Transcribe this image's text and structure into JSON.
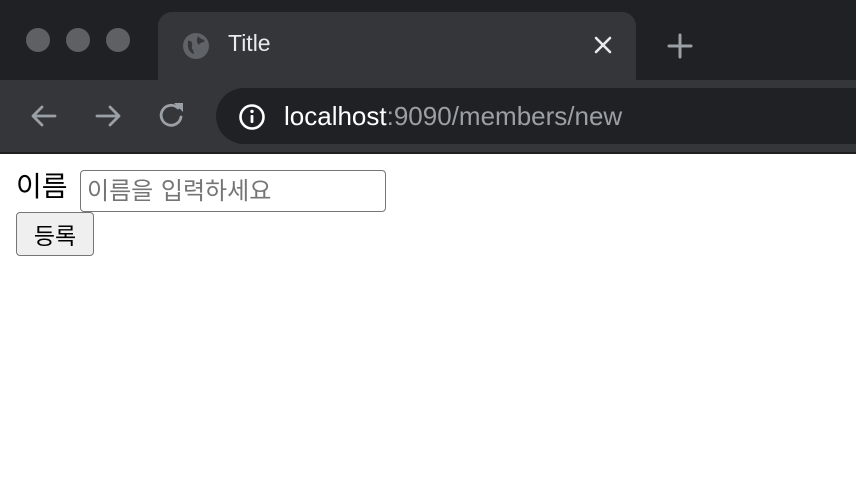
{
  "window": {
    "controls": [
      "close",
      "minimize",
      "zoom"
    ]
  },
  "tab": {
    "title": "Title",
    "favicon": "globe-icon",
    "close_icon": "close-icon"
  },
  "new_tab_icon": "plus-icon",
  "toolbar": {
    "back_icon": "arrow-left-icon",
    "forward_icon": "arrow-right-icon",
    "reload_icon": "reload-icon",
    "site_info_icon": "info-icon",
    "url_host": "localhost",
    "url_path": ":9090/members/new"
  },
  "form": {
    "name_label": "이름",
    "name_input_value": "",
    "name_input_placeholder": "이름을 입력하세요",
    "submit_label": "등록"
  },
  "colors": {
    "tabstrip": "#202124",
    "toolbar": "#35363a",
    "omnibox": "#202124",
    "icon": "#9aa0a6"
  }
}
